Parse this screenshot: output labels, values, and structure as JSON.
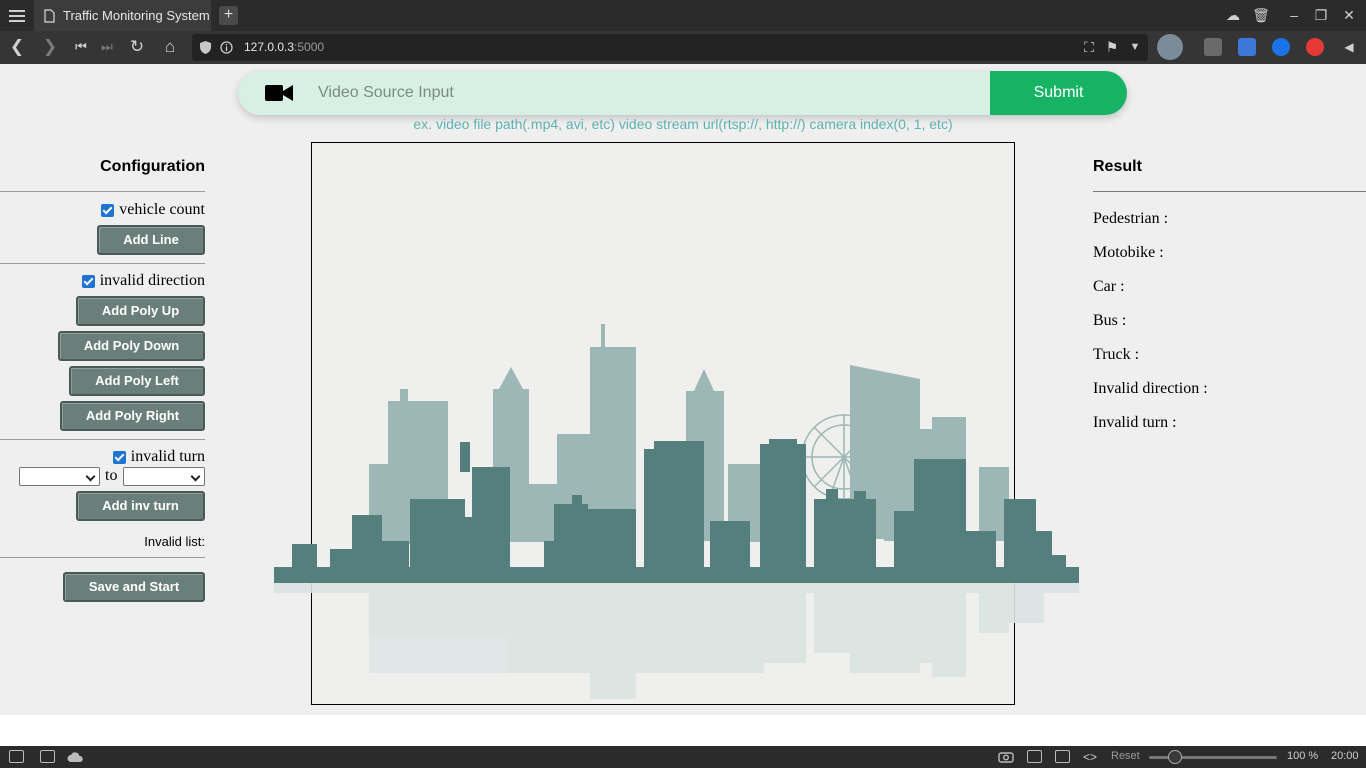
{
  "browser": {
    "tab_title": "Traffic Monitoring System",
    "url_host": "127.0.0.3",
    "url_port": ":5000"
  },
  "source": {
    "placeholder": "Video Source Input",
    "submit_label": "Submit",
    "hint": "ex. video file path(.mp4, avi, etc) video stream url(rtsp://, http://) camera index(0, 1, etc)"
  },
  "config": {
    "title": "Configuration",
    "vehicle_count_label": "vehicle count",
    "add_line_label": "Add Line",
    "invalid_direction_label": "invalid direction",
    "add_poly_up_label": "Add Poly Up",
    "add_poly_down_label": "Add Poly Down",
    "add_poly_left_label": "Add Poly Left",
    "add_poly_right_label": "Add Poly Right",
    "invalid_turn_label": "invalid turn",
    "to_label": "to",
    "add_inv_turn_label": "Add inv turn",
    "invalid_list_label": "Invalid list:",
    "save_start_label": "Save and Start"
  },
  "result": {
    "title": "Result",
    "items": [
      "Pedestrian :",
      "Motobike :",
      "Car :",
      "Bus :",
      "Truck :",
      "Invalid direction :",
      "Invalid turn :"
    ]
  },
  "statusbar": {
    "reset_label": "Reset",
    "zoom": "100 %",
    "clock": "20:00"
  },
  "colors": {
    "submit_green": "#16b364",
    "source_bg": "#d8f0e3",
    "hint_teal": "#5bb3b0",
    "button_gray": "#6b7f7a",
    "skyline_dark": "#557f7d",
    "skyline_light": "#9cb7b5"
  }
}
